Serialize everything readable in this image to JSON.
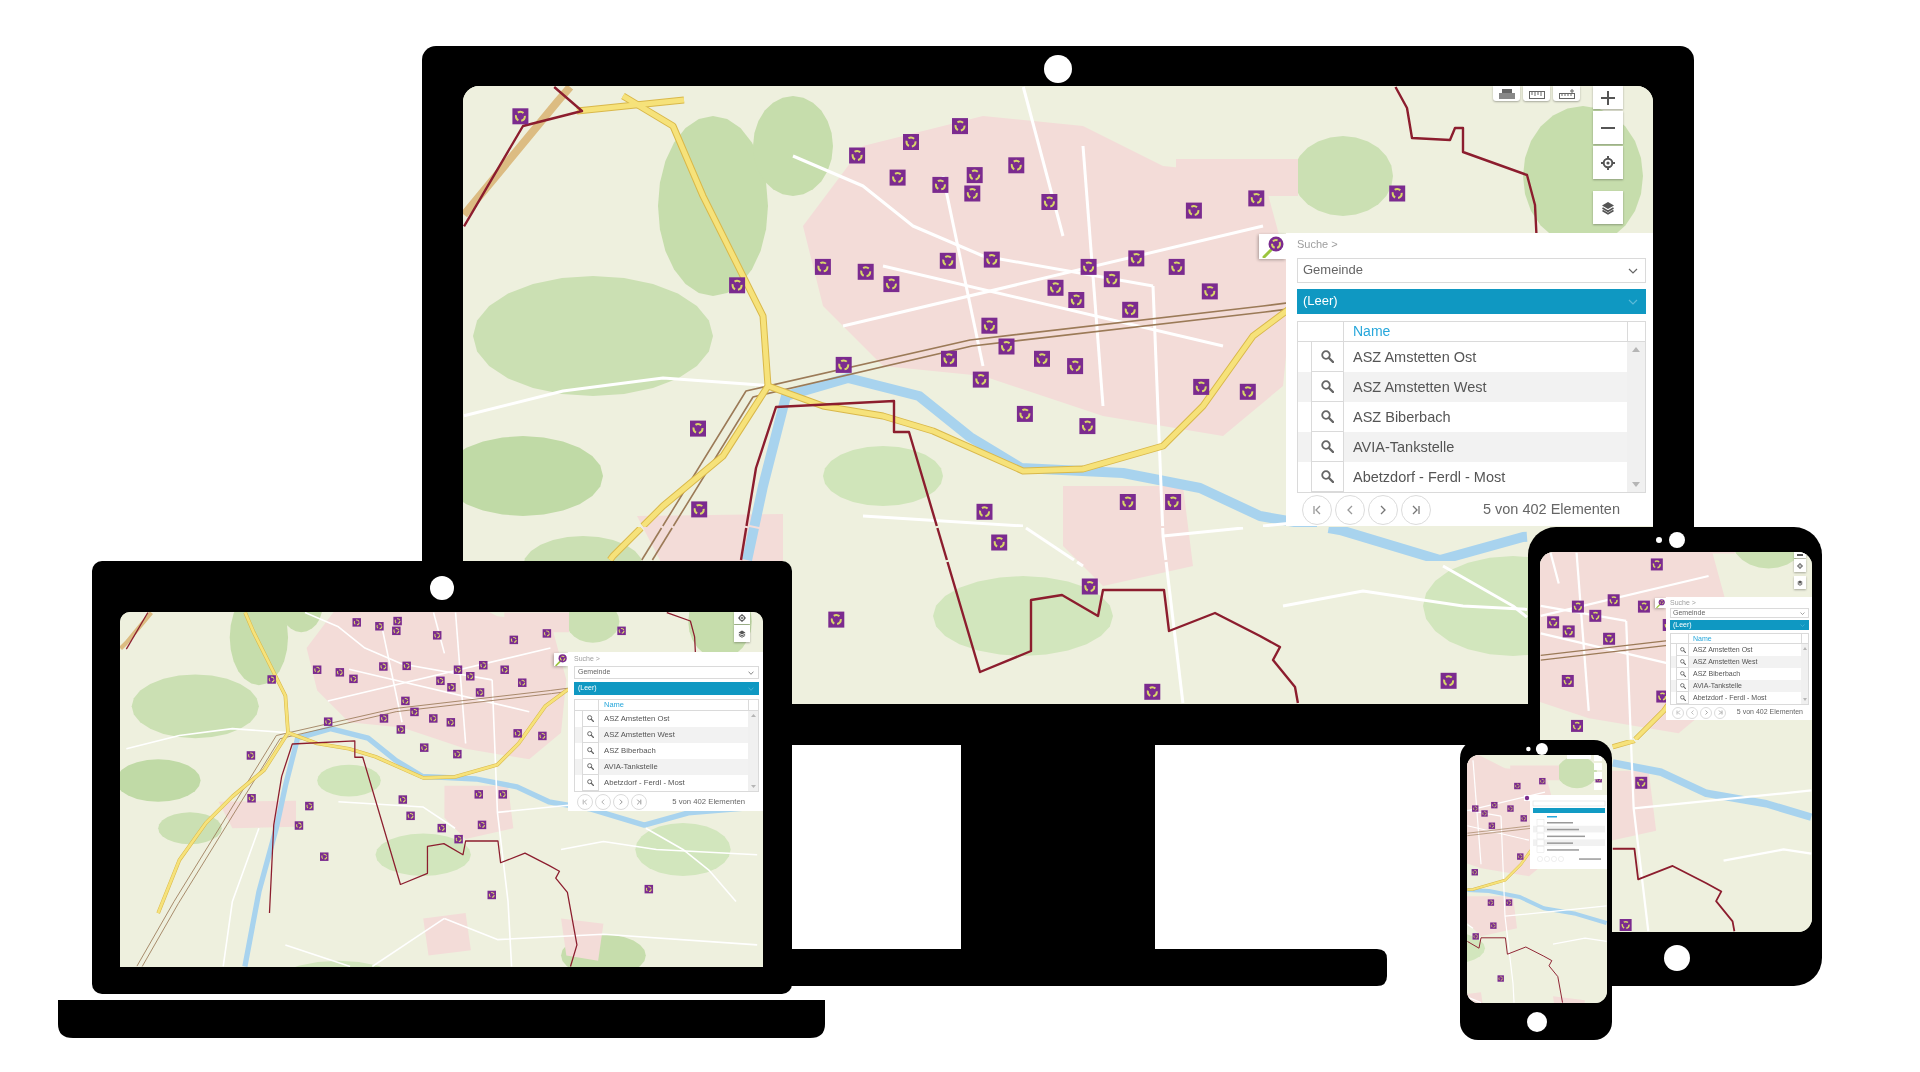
{
  "devices": [
    {
      "kind": "monitor",
      "search_panel": {
        "heading": "Suche >",
        "category_select": {
          "value": "Gemeinde"
        },
        "value_select": {
          "value": "(Leer)"
        },
        "table": {
          "columns": [
            "Name"
          ],
          "rows": [
            "ASZ Amstetten Ost",
            "ASZ Amstetten West",
            "ASZ Biberbach",
            "AVIA-Tankstelle",
            "Abetzdorf - Ferdl - Most"
          ]
        },
        "pagination": {
          "summary": "5 von 402 Elementen"
        }
      }
    },
    {
      "kind": "laptop",
      "search_panel": {
        "heading": "Suche >",
        "category_select": {
          "value": "Gemeinde"
        },
        "value_select": {
          "value": "(Leer)"
        },
        "table": {
          "columns": [
            "Name"
          ],
          "rows": [
            "ASZ Amstetten Ost",
            "ASZ Amstetten West",
            "ASZ Biberbach",
            "AVIA-Tankstelle",
            "Abetzdorf - Ferdl - Most"
          ]
        },
        "pagination": {
          "summary": "5 von 402 Elementen"
        }
      }
    },
    {
      "kind": "tablet",
      "search_panel": {
        "heading": "Suche >",
        "category_select": {
          "value": "Gemeinde"
        },
        "value_select": {
          "value": "(Leer)"
        },
        "table": {
          "columns": [
            "Name"
          ],
          "rows": [
            "ASZ Amstetten Ost",
            "ASZ Amstetten West",
            "ASZ Biberbach",
            "AVIA-Tankstelle",
            "Abetzdorf - Ferdl - Most"
          ]
        },
        "pagination": {
          "summary": "5 von 402 Elementen"
        }
      }
    },
    {
      "kind": "phone"
    }
  ]
}
